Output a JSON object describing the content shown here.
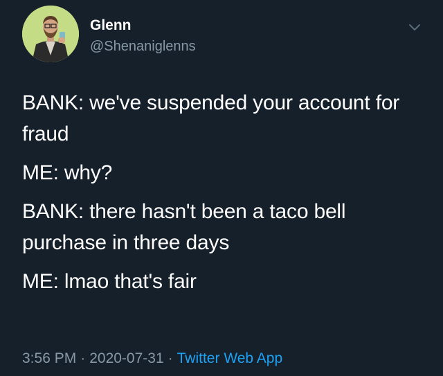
{
  "author": {
    "display_name": "Glenn",
    "handle": "@Shenaniglenns",
    "avatar_icon": "profile-photo"
  },
  "menu": {
    "icon": "chevron-down-icon"
  },
  "paragraphs": [
    "BANK: we've suspended your account for fraud",
    "ME: why?",
    "BANK: there hasn't been a taco bell purchase in three days",
    "ME: lmao that's fair"
  ],
  "meta": {
    "time": "3:56 PM",
    "separator": "·",
    "date": "2020-07-31",
    "source": "Twitter Web App"
  },
  "colors": {
    "background": "#15202b",
    "text": "#ffffff",
    "secondary": "#8899a6",
    "link": "#1da1f2"
  }
}
